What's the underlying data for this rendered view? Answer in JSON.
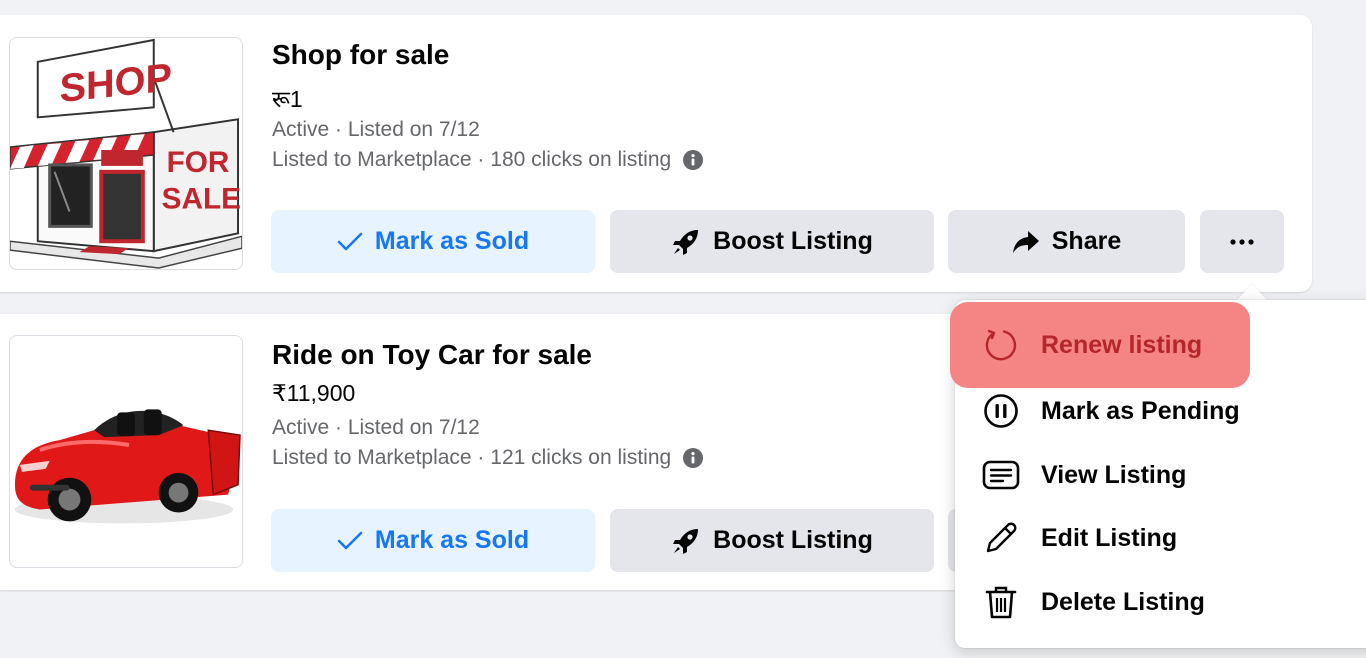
{
  "listings": [
    {
      "title": "Shop for sale",
      "price": "रू1",
      "status_line": "Active · Listed on 7/12",
      "reach_line": "Listed to Marketplace · 180 clicks on listing",
      "image_label": "shop-for-sale-image",
      "image_text_top": "SHOP",
      "image_text_for": "FOR",
      "image_text_sale": "SALE"
    },
    {
      "title": "Ride on Toy Car for sale",
      "price": "₹11,900",
      "status_line": "Active · Listed on 7/12",
      "reach_line": "Listed to Marketplace · 121 clicks on listing",
      "image_label": "red-toy-car-image"
    }
  ],
  "actions": {
    "mark_sold": "Mark as Sold",
    "boost": "Boost Listing",
    "share": "Share",
    "more": "···"
  },
  "menu": {
    "items": [
      {
        "label": "Renew listing",
        "icon": "refresh-icon",
        "highlighted": true
      },
      {
        "label": "Mark as Pending",
        "icon": "pause-icon"
      },
      {
        "label": "View Listing",
        "icon": "listing-icon"
      },
      {
        "label": "Edit Listing",
        "icon": "pencil-icon"
      },
      {
        "label": "Delete Listing",
        "icon": "trash-icon"
      }
    ]
  },
  "colors": {
    "accent": "#1877f2",
    "accent_bg": "#e7f3ff",
    "button_bg": "#e4e6eb",
    "page_bg": "#f0f2f5",
    "highlight_bg": "#f58484",
    "highlight_text": "#b3272b",
    "secondary_text": "#65676b"
  }
}
